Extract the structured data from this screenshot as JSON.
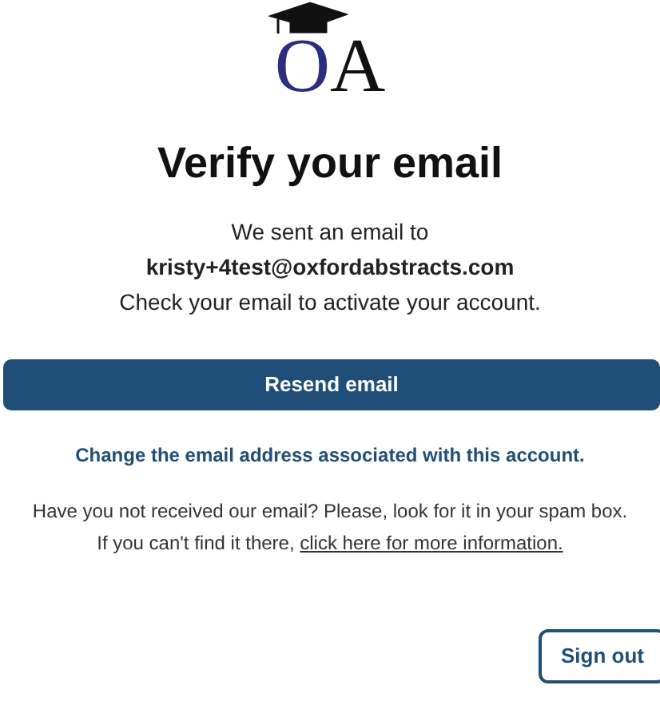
{
  "logo": {
    "letter_1": "O",
    "letter_2": "A"
  },
  "heading": "Verify your email",
  "message": {
    "line_1": "We sent an email to",
    "email": "kristy+4test@oxfordabstracts.com",
    "line_2": "Check your email to activate your account."
  },
  "resend_button": "Resend email",
  "change_email_link": "Change the email address associated with this account.",
  "help": {
    "text": "Have you not received our email? Please, look for it in your spam box. If you can't find it there, ",
    "link": "click here for more information."
  },
  "sign_out_button": "Sign out"
}
